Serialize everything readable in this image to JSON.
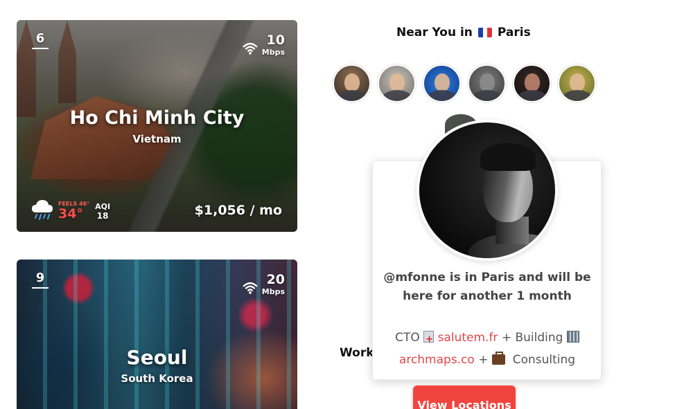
{
  "cities": [
    {
      "rank": "6",
      "name": "Ho Chi Minh City",
      "country": "Vietnam",
      "internet_speed": "10",
      "internet_unit": "Mbps",
      "feels_like": "FEELS 46°",
      "temperature": "34°",
      "aqi_label": "AQI",
      "aqi_value": "18",
      "cost": "$1,056 / mo",
      "weather_icon": "rain-cloud-icon"
    },
    {
      "rank": "9",
      "name": "Seoul",
      "country": "South Korea",
      "internet_speed": "20",
      "internet_unit": "Mbps"
    }
  ],
  "near_you": {
    "title_prefix": "Near You in",
    "city": "Paris",
    "flag": "flag-france-icon",
    "avatar_count": 6
  },
  "popover": {
    "message": "@mfonne is in Paris and will be here for another 1 month",
    "line1_role": "CTO",
    "line1_link": "salutem.fr",
    "line1_sep": "+ Building",
    "line2_link": "archmaps.co",
    "line2_sep": "+",
    "line2_tail": "Consulting"
  },
  "work_label": "Work",
  "view_button": "View Locations",
  "colors": {
    "accent": "#f0453f",
    "link": "#e0474c",
    "temp": "#ff4d4d"
  }
}
